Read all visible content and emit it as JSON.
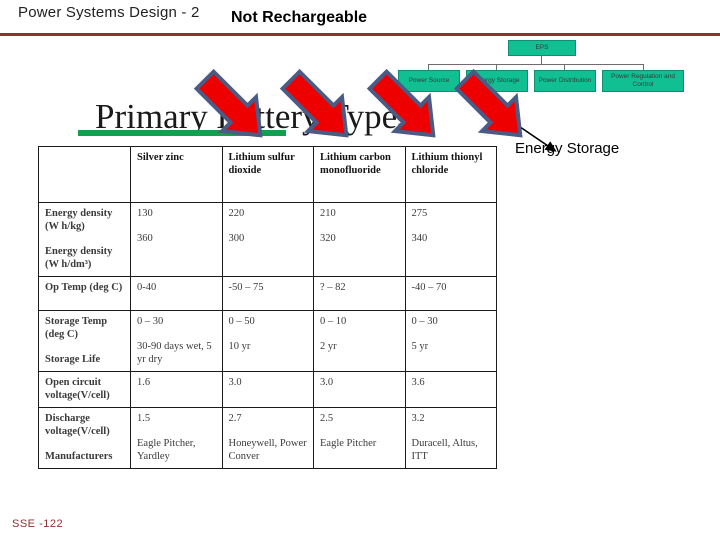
{
  "slide": {
    "header_title": "Power Systems Design - 2",
    "header_subtitle": "Not Rechargeable",
    "body_title": "Primary Battery Types",
    "footer_code": "SSE -122",
    "rule_color": "#8f2f2f",
    "underline_color": "#12a050"
  },
  "eps_diagram": {
    "root": "EPS",
    "children": [
      "Power Source",
      "Energy Storage",
      "Power Distribution",
      "Power Regulation and Control"
    ],
    "box_color": "#10bf92"
  },
  "callout": {
    "energy_storage_label": "Energy Storage",
    "arrow_color": "#ee0000",
    "arrow_outline_color": "#4a5b85",
    "arrow_count": 4
  },
  "table": {
    "columns": [
      "",
      "Silver zinc",
      "Lithium sulfur dioxide",
      "Lithium carbon monofluoride",
      "Lithium thionyl chloride"
    ],
    "rows": [
      {
        "label": [
          "Energy density (W h/kg)",
          "Energy density (W h/dm³)"
        ],
        "cells": [
          [
            "130",
            "360"
          ],
          [
            "220",
            "300"
          ],
          [
            "210",
            "320"
          ],
          [
            "275",
            "340"
          ]
        ]
      },
      {
        "label": [
          "Op Temp (deg C)"
        ],
        "cells": [
          [
            "0-40"
          ],
          [
            "-50 – 75"
          ],
          [
            "? – 82"
          ],
          [
            "-40 – 70"
          ]
        ]
      },
      {
        "label": [
          "Storage Temp (deg C)",
          "Storage Life"
        ],
        "cells": [
          [
            "0 – 30",
            "30-90 days wet, 5 yr dry"
          ],
          [
            "0 – 50",
            "10 yr"
          ],
          [
            "0 – 10",
            "2 yr"
          ],
          [
            "0 – 30",
            "5 yr"
          ]
        ]
      },
      {
        "label": [
          "Open circuit voltage(V/cell)"
        ],
        "cells": [
          [
            "1.6"
          ],
          [
            "3.0"
          ],
          [
            "3.0"
          ],
          [
            "3.6"
          ]
        ]
      },
      {
        "label": [
          "Discharge voltage(V/cell)",
          "Manufacturers"
        ],
        "cells": [
          [
            "1.5",
            "Eagle Pitcher, Yardley"
          ],
          [
            "2.7",
            "Honeywell, Power Conver"
          ],
          [
            "2.5",
            "Eagle Pitcher"
          ],
          [
            "3.2",
            "Duracell, Altus, ITT"
          ]
        ]
      }
    ]
  }
}
